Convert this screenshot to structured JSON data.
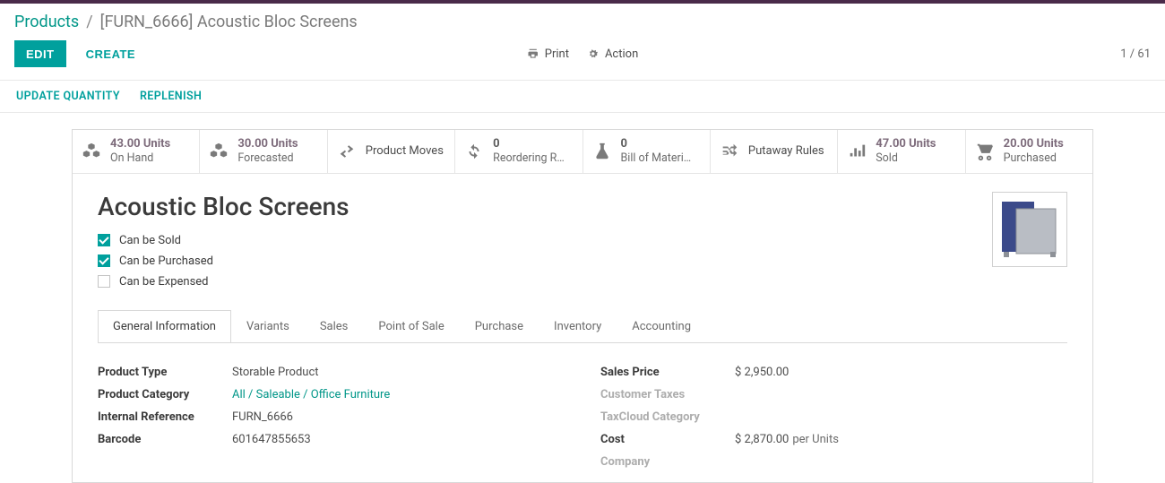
{
  "breadcrumb": {
    "root": "Products",
    "current": "[FURN_6666] Acoustic Bloc Screens"
  },
  "buttons": {
    "edit": "EDIT",
    "create": "CREATE",
    "print": "Print",
    "action": "Action"
  },
  "pager": {
    "text": "1 / 61"
  },
  "subactions": {
    "update_qty": "UPDATE QUANTITY",
    "replenish": "REPLENISH"
  },
  "stats": {
    "on_hand": {
      "val": "43.00 Units",
      "label": "On Hand"
    },
    "forecasted": {
      "val": "30.00 Units",
      "label": "Forecasted"
    },
    "product_moves": {
      "label": "Product Moves"
    },
    "reordering": {
      "val": "0",
      "label": "Reordering R…"
    },
    "bom": {
      "val": "0",
      "label": "Bill of Materi…"
    },
    "putaway": {
      "label": "Putaway Rules"
    },
    "sold": {
      "val": "47.00 Units",
      "label": "Sold"
    },
    "purchased": {
      "val": "20.00 Units",
      "label": "Purchased"
    }
  },
  "header": {
    "title": "Acoustic Bloc Screens",
    "can_be_sold": "Can be Sold",
    "can_be_purchased": "Can be Purchased",
    "can_be_expensed": "Can be Expensed"
  },
  "tabs": {
    "general": "General Information",
    "variants": "Variants",
    "sales": "Sales",
    "pos": "Point of Sale",
    "purchase": "Purchase",
    "inventory": "Inventory",
    "accounting": "Accounting"
  },
  "fields": {
    "product_type": {
      "label": "Product Type",
      "value": "Storable Product"
    },
    "product_category": {
      "label": "Product Category",
      "value": "All / Saleable / Office Furniture"
    },
    "internal_ref": {
      "label": "Internal Reference",
      "value": "FURN_6666"
    },
    "barcode": {
      "label": "Barcode",
      "value": "601647855653"
    },
    "sales_price": {
      "label": "Sales Price",
      "value": "$ 2,950.00"
    },
    "customer_taxes": {
      "label": "Customer Taxes",
      "value": ""
    },
    "taxcloud": {
      "label": "TaxCloud Category",
      "value": ""
    },
    "cost": {
      "label": "Cost",
      "value": "$ 2,870.00",
      "per": "per Units"
    },
    "company": {
      "label": "Company",
      "value": ""
    }
  }
}
